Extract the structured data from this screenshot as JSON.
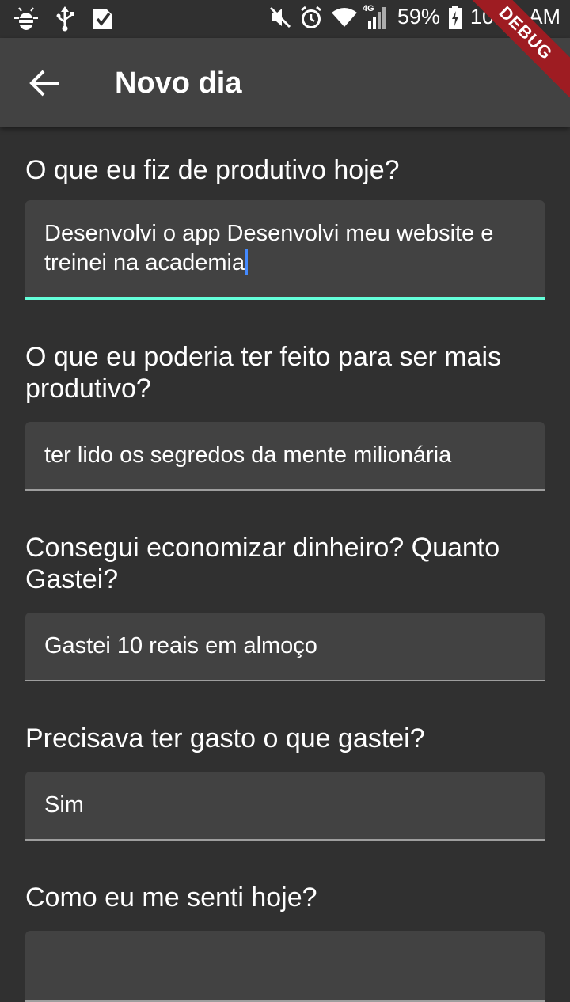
{
  "status_bar": {
    "battery_percent": "59%",
    "time": "10:23 AM",
    "network_label": "4G",
    "icons": [
      "bug-icon",
      "usb-icon",
      "task-check-icon",
      "mute-icon",
      "alarm-icon",
      "wifi-icon",
      "signal-icon",
      "battery-charging-icon"
    ]
  },
  "app_bar": {
    "title": "Novo dia",
    "back_icon": "arrow-back-icon"
  },
  "debug_banner": "DEBUG",
  "form": {
    "q1": {
      "label": "O que eu fiz de produtivo hoje?",
      "value": "Desenvolvi o app Desenvolvi meu website e treinei na academia"
    },
    "q2": {
      "label": "O que eu poderia ter feito para ser mais produtivo?",
      "value": "ter lido os segredos da mente milionária"
    },
    "q3": {
      "label": "Consegui economizar dinheiro? Quanto Gastei?",
      "value": "Gastei 10 reais em almoço"
    },
    "q4": {
      "label": "Precisava ter gasto o que gastei?",
      "value": "Sim"
    },
    "q5": {
      "label": "Como eu me senti hoje?",
      "value": ""
    }
  },
  "colors": {
    "background": "#303030",
    "app_bar": "#424242",
    "field_fill": "#424242",
    "focus_underline": "#64ffda",
    "caret": "#448aff",
    "debug_banner": "#9e1c22"
  }
}
